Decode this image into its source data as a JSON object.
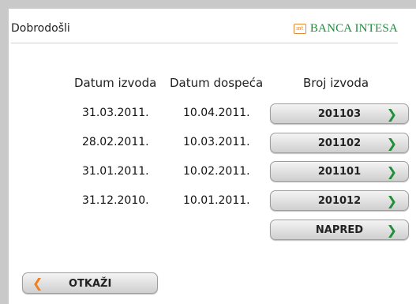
{
  "header": {
    "welcome": "Dobrodošli",
    "brand_logo_text": "ınt",
    "brand_name": "BANCA INTESA"
  },
  "table": {
    "columns": [
      "Datum izvoda",
      "Datum dospeća",
      "Broj izvoda"
    ],
    "rows": [
      {
        "statement_date": "31.03.2011.",
        "due_date": "10.04.2011.",
        "number": "201103"
      },
      {
        "statement_date": "28.02.2011.",
        "due_date": "10.03.2011.",
        "number": "201102"
      },
      {
        "statement_date": "31.01.2011.",
        "due_date": "10.02.2011.",
        "number": "201101"
      },
      {
        "statement_date": "31.12.2010.",
        "due_date": "10.01.2011.",
        "number": "201012"
      }
    ]
  },
  "buttons": {
    "next_label": "NAPRED",
    "cancel_label": "OTKAŽI",
    "chevron_right": "❯",
    "chevron_left": "❮"
  },
  "colors": {
    "brand_green": "#1e8a3c",
    "accent_orange": "#f07f1f",
    "background": "#c9c9c9"
  }
}
